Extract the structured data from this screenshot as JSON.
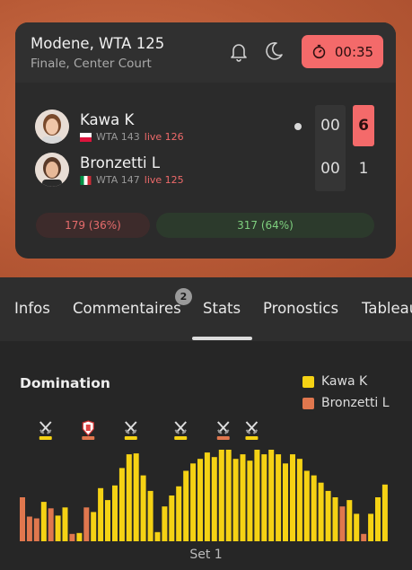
{
  "match": {
    "title": "Modene, WTA 125",
    "subtitle": "Finale, Center Court",
    "timer": "00:35",
    "icons": [
      "bell-icon",
      "moon-icon",
      "stopwatch-icon"
    ]
  },
  "players": [
    {
      "name": "Kawa K",
      "rank": "WTA 143",
      "live": "live 126",
      "flag": "poland",
      "points": "00",
      "games": "6",
      "serving": true
    },
    {
      "name": "Bronzetti L",
      "rank": "WTA 147",
      "live": "live 125",
      "flag": "italy",
      "points": "00",
      "games": "1",
      "serving": false
    }
  ],
  "stats_bar": {
    "left": "179 (36%)",
    "right": "317 (64%)"
  },
  "tabs": [
    {
      "label": "Infos"
    },
    {
      "label": "Commentaires",
      "badge": "2"
    },
    {
      "label": "Stats",
      "active": true
    },
    {
      "label": "Pronostics"
    },
    {
      "label": "Tableau"
    }
  ],
  "colors": {
    "accent": "#f46a6a",
    "player1": "#f5d214",
    "player2": "#e0774e"
  },
  "chart_data": {
    "type": "bar",
    "title": "Domination",
    "xlabel": "Set 1",
    "series": [
      {
        "name": "Kawa K",
        "color": "#f5d214"
      },
      {
        "name": "Bronzetti L",
        "color": "#e0774e"
      }
    ],
    "bars": [
      {
        "v": 48,
        "p": 2
      },
      {
        "v": 27,
        "p": 2
      },
      {
        "v": 25,
        "p": 2
      },
      {
        "v": 43,
        "p": 1
      },
      {
        "v": 36,
        "p": 2
      },
      {
        "v": 28,
        "p": 1
      },
      {
        "v": 37,
        "p": 1
      },
      {
        "v": 8,
        "p": 2
      },
      {
        "v": 9,
        "p": 1
      },
      {
        "v": 37,
        "p": 2
      },
      {
        "v": 32,
        "p": 1
      },
      {
        "v": 58,
        "p": 1
      },
      {
        "v": 45,
        "p": 1
      },
      {
        "v": 61,
        "p": 1
      },
      {
        "v": 80,
        "p": 1
      },
      {
        "v": 95,
        "p": 1
      },
      {
        "v": 96,
        "p": 1
      },
      {
        "v": 72,
        "p": 1
      },
      {
        "v": 55,
        "p": 1
      },
      {
        "v": 10,
        "p": 1
      },
      {
        "v": 38,
        "p": 1
      },
      {
        "v": 50,
        "p": 1
      },
      {
        "v": 60,
        "p": 1
      },
      {
        "v": 77,
        "p": 1
      },
      {
        "v": 85,
        "p": 1
      },
      {
        "v": 90,
        "p": 1
      },
      {
        "v": 97,
        "p": 1
      },
      {
        "v": 92,
        "p": 1
      },
      {
        "v": 100,
        "p": 1
      },
      {
        "v": 100,
        "p": 1
      },
      {
        "v": 90,
        "p": 1
      },
      {
        "v": 95,
        "p": 1
      },
      {
        "v": 88,
        "p": 1
      },
      {
        "v": 100,
        "p": 1
      },
      {
        "v": 95,
        "p": 1
      },
      {
        "v": 100,
        "p": 1
      },
      {
        "v": 95,
        "p": 1
      },
      {
        "v": 85,
        "p": 1
      },
      {
        "v": 95,
        "p": 1
      },
      {
        "v": 90,
        "p": 1
      },
      {
        "v": 77,
        "p": 1
      },
      {
        "v": 72,
        "p": 1
      },
      {
        "v": 64,
        "p": 1
      },
      {
        "v": 55,
        "p": 1
      },
      {
        "v": 48,
        "p": 1
      },
      {
        "v": 38,
        "p": 2
      },
      {
        "v": 45,
        "p": 1
      },
      {
        "v": 30,
        "p": 1
      },
      {
        "v": 8,
        "p": 2
      },
      {
        "v": 30,
        "p": 1
      },
      {
        "v": 48,
        "p": 1
      },
      {
        "v": 62,
        "p": 1
      }
    ],
    "markers": [
      {
        "type": "break",
        "player": 1,
        "bar": 3
      },
      {
        "type": "hold",
        "player": 2,
        "bar": 9
      },
      {
        "type": "break",
        "player": 1,
        "bar": 15
      },
      {
        "type": "break",
        "player": 1,
        "bar": 22
      },
      {
        "type": "break",
        "player": 2,
        "bar": 28
      },
      {
        "type": "break",
        "player": 1,
        "bar": 32
      }
    ],
    "ylim": [
      0,
      100
    ]
  }
}
